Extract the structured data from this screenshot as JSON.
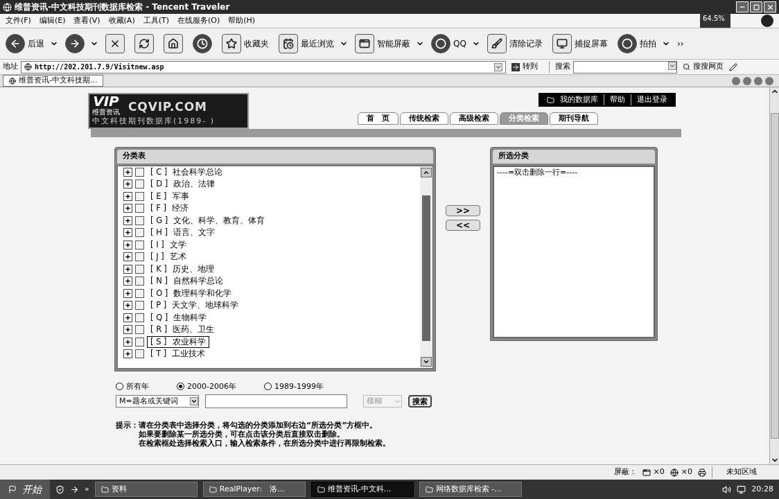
{
  "window": {
    "title": "维普资讯-中文科技期刊数据库检索 - Tencent Traveler",
    "badge": "64.5%"
  },
  "menu": [
    "文件(F)",
    "编辑(E)",
    "查看(V)",
    "收藏(A)",
    "工具(T)",
    "在线服务(O)",
    "帮助(H)"
  ],
  "toolbar": [
    {
      "kind": "back",
      "label": "后退",
      "dropdown": true
    },
    {
      "kind": "forward",
      "dropdown": true
    },
    {
      "kind": "stop"
    },
    {
      "kind": "refresh"
    },
    {
      "kind": "home"
    },
    {
      "kind": "history"
    },
    {
      "kind": "favorites",
      "label": "收藏夹"
    },
    {
      "kind": "recent",
      "label": "最近浏览",
      "dropdown": true
    },
    {
      "kind": "block",
      "label": "智能屏蔽",
      "dropdown": true
    },
    {
      "kind": "qq",
      "label": "QQ",
      "dropdown": true
    },
    {
      "kind": "clear",
      "label": "清除记录"
    },
    {
      "kind": "capture",
      "label": "捕捉屏幕"
    },
    {
      "kind": "paipai",
      "label": "拍拍",
      "dropdown": true
    }
  ],
  "toolbar_more": "››",
  "address": {
    "label": "地址",
    "value": "http://202.201.7.9/Visitnew.asp",
    "go": "转到",
    "search_label": "搜索",
    "search_engine": "搜搜网页"
  },
  "tabs": [
    {
      "label": "维普资讯-中文科技期...",
      "selected": true
    }
  ],
  "page": {
    "logo": {
      "mark": "VIP",
      "mark_sub": "维普资讯",
      "site": "CQVIP.COM",
      "subtitle": "中文科技期刊数据库(1989- )"
    },
    "user_links": [
      "我的数据库",
      "帮助",
      "退出登录"
    ],
    "nav": [
      {
        "label": "首　页",
        "selected": false
      },
      {
        "label": "传统检索",
        "selected": false
      },
      {
        "label": "高级检索",
        "selected": false
      },
      {
        "label": "分类检索",
        "selected": true
      },
      {
        "label": "期刊导航",
        "selected": false
      }
    ],
    "category_panel": {
      "title": "分类表",
      "items": [
        {
          "code": "[ C ]",
          "name": "社会科学总论",
          "checked": false,
          "focused": false
        },
        {
          "code": "[ D ]",
          "name": "政治、法律",
          "checked": false,
          "focused": false
        },
        {
          "code": "[ E ]",
          "name": "军事",
          "checked": false,
          "focused": false
        },
        {
          "code": "[ F ]",
          "name": "经济",
          "checked": false,
          "focused": false
        },
        {
          "code": "[ G ]",
          "name": "文化、科学、教育、体育",
          "checked": false,
          "focused": false
        },
        {
          "code": "[ H ]",
          "name": "语言、文字",
          "checked": false,
          "focused": false
        },
        {
          "code": "[ I ]",
          "name": "文学",
          "checked": false,
          "focused": false
        },
        {
          "code": "[ J ]",
          "name": "艺术",
          "checked": false,
          "focused": false
        },
        {
          "code": "[ K ]",
          "name": "历史、地理",
          "checked": false,
          "focused": false
        },
        {
          "code": "[ N ]",
          "name": "自然科学总论",
          "checked": false,
          "focused": false
        },
        {
          "code": "[ O ]",
          "name": "数理科学和化学",
          "checked": false,
          "focused": false
        },
        {
          "code": "[ P ]",
          "name": "天文学、地球科学",
          "checked": false,
          "focused": false
        },
        {
          "code": "[ Q ]",
          "name": "生物科学",
          "checked": false,
          "focused": false
        },
        {
          "code": "[ R ]",
          "name": "医药、卫生",
          "checked": false,
          "focused": false
        },
        {
          "code": "[ S ]",
          "name": "农业科学",
          "checked": false,
          "focused": true
        },
        {
          "code": "[ T ]",
          "name": "工业技术",
          "checked": false,
          "focused": false
        }
      ]
    },
    "transfer": [
      ">>",
      "<<"
    ],
    "selected_panel": {
      "title": "所选分类",
      "items": [
        "----=双击删除一行=----"
      ]
    },
    "years": [
      {
        "label": "所有年",
        "selected": false
      },
      {
        "label": "2000-2006年",
        "selected": true
      },
      {
        "label": "1989-1999年",
        "selected": false
      }
    ],
    "search": {
      "field": "M=题名或关键词",
      "match": "模糊",
      "match_disabled": true,
      "button": "搜索"
    },
    "hint": {
      "label": "提示：",
      "lines": [
        "请在分类表中选择分类，将勾选的分类添加到右边“所选分类”方框中。",
        "如果要删除某一所选分类，可在点击该分类后直接双击删除。",
        "在检索框处选择检索入口，输入检索条件，在所选分类中进行再限制检索。"
      ]
    }
  },
  "status_bar": {
    "block_label": "屏蔽：",
    "counts": [
      "×0",
      "×0"
    ],
    "zone": "未知区域"
  },
  "taskbar": {
    "start": "开始",
    "more": "»",
    "items": [
      {
        "label": "资料",
        "selected": false
      },
      {
        "label": "RealPlayer:　洛...",
        "selected": false
      },
      {
        "label": "维普资讯-中文科...",
        "selected": true
      },
      {
        "label": "网络数据库检索 -...",
        "selected": false
      }
    ],
    "clock": "20:28"
  }
}
